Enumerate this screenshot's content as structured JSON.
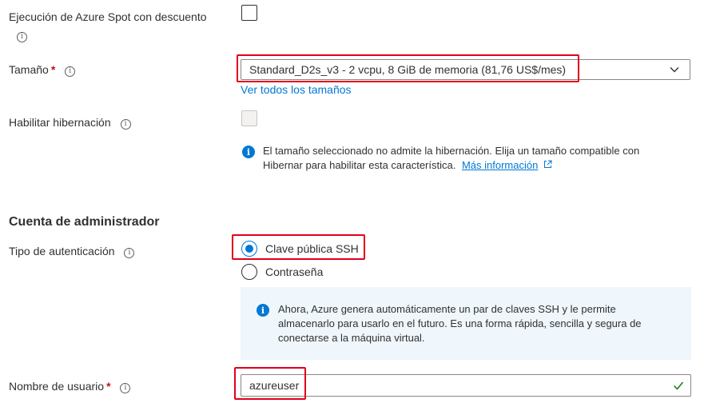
{
  "spot": {
    "label_line1": "Ejecución de Azure Spot con descuento"
  },
  "size": {
    "label": "Tamaño",
    "required": "*",
    "selected": "Standard_D2s_v3 - 2 vcpu, 8 GiB de memoria (81,76 US$/mes)",
    "see_all_link": "Ver todos los tamaños"
  },
  "hibernation": {
    "label": "Habilitar hibernación",
    "message": "El tamaño seleccionado no admite la hibernación. Elija un tamaño compatible con Hibernar para habilitar esta característica.",
    "message_line1": "El tamaño seleccionado no admite la hibernación. Elija un tamaño compatible con",
    "message_line2": "Hibernar para habilitar esta característica.",
    "more_link": "Más información"
  },
  "admin": {
    "title": "Cuenta de administrador",
    "auth_label": "Tipo de autenticación",
    "options": [
      "Clave pública SSH",
      "Contraseña"
    ],
    "selected_option": "Clave pública SSH",
    "ssh_info_line1": "Ahora, Azure genera automáticamente un par de claves SSH y le permite",
    "ssh_info_line2": "almacenarlo para usarlo en el futuro. Es una forma rápida, sencilla y segura de",
    "ssh_info_line3": "conectarse a la máquina virtual.",
    "username_label": "Nombre de usuario",
    "username_required": "*",
    "username_value": "azureuser"
  },
  "colors": {
    "accent": "#0078d4",
    "highlight": "#e0001b",
    "required": "#c50f1f",
    "valid": "#107c10"
  }
}
